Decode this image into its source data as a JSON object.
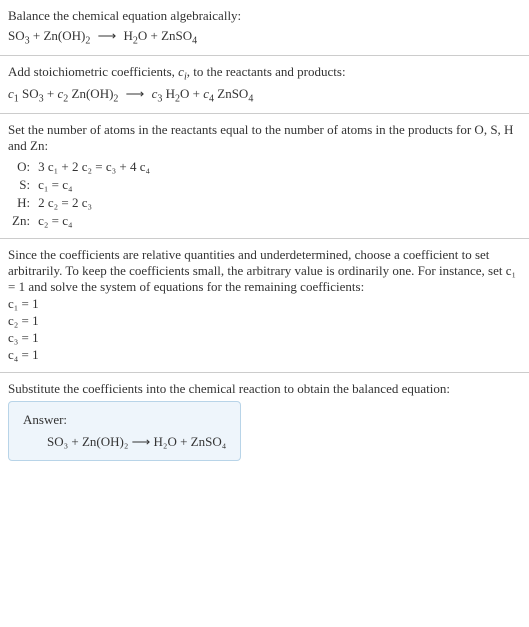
{
  "section1": {
    "intro": "Balance the chemical equation algebraically:",
    "eq_so3": "SO",
    "eq_so3_sub": "3",
    "plus1": " + Zn(OH)",
    "znoh_sub": "2",
    "arrow": " ⟶ ",
    "h2o": "H",
    "h2o_sub": "2",
    "h2o_o": "O + ZnSO",
    "znso4_sub": "4"
  },
  "section2": {
    "intro_a": "Add stoichiometric coefficients, ",
    "ci": "c",
    "ci_sub": "i",
    "intro_b": ", to the reactants and products:",
    "c1": "c",
    "c1_sub": "1",
    "sp1": " SO",
    "so3_sub": "3",
    "plus1": " + ",
    "c2": "c",
    "c2_sub": "2",
    "sp2": " Zn(OH)",
    "znoh_sub": "2",
    "arrow": " ⟶ ",
    "c3": "c",
    "c3_sub": "3",
    "sp3": " H",
    "h2_sub": "2",
    "o_plus": "O + ",
    "c4": "c",
    "c4_sub": "4",
    "sp4": " ZnSO",
    "znso4_sub": "4"
  },
  "section3": {
    "intro": "Set the number of atoms in the reactants equal to the number of atoms in the products for O, S, H and Zn:",
    "rows": [
      {
        "el": "O:",
        "eq": "3 c₁ + 2 c₂ = c₃ + 4 c₄"
      },
      {
        "el": "S:",
        "eq": "c₁ = c₄"
      },
      {
        "el": "H:",
        "eq": "2 c₂ = 2 c₃"
      },
      {
        "el": "Zn:",
        "eq": "c₂ = c₄"
      }
    ]
  },
  "section4": {
    "intro": "Since the coefficients are relative quantities and underdetermined, choose a coefficient to set arbitrarily. To keep the coefficients small, the arbitrary value is ordinarily one. For instance, set c₁ = 1 and solve the system of equations for the remaining coefficients:",
    "coefs": [
      "c₁ = 1",
      "c₂ = 1",
      "c₃ = 1",
      "c₄ = 1"
    ]
  },
  "section5": {
    "intro": "Substitute the coefficients into the chemical reaction to obtain the balanced equation:",
    "answer_label": "Answer:",
    "eq": "SO₃ + Zn(OH)₂  ⟶  H₂O + ZnSO₄"
  }
}
